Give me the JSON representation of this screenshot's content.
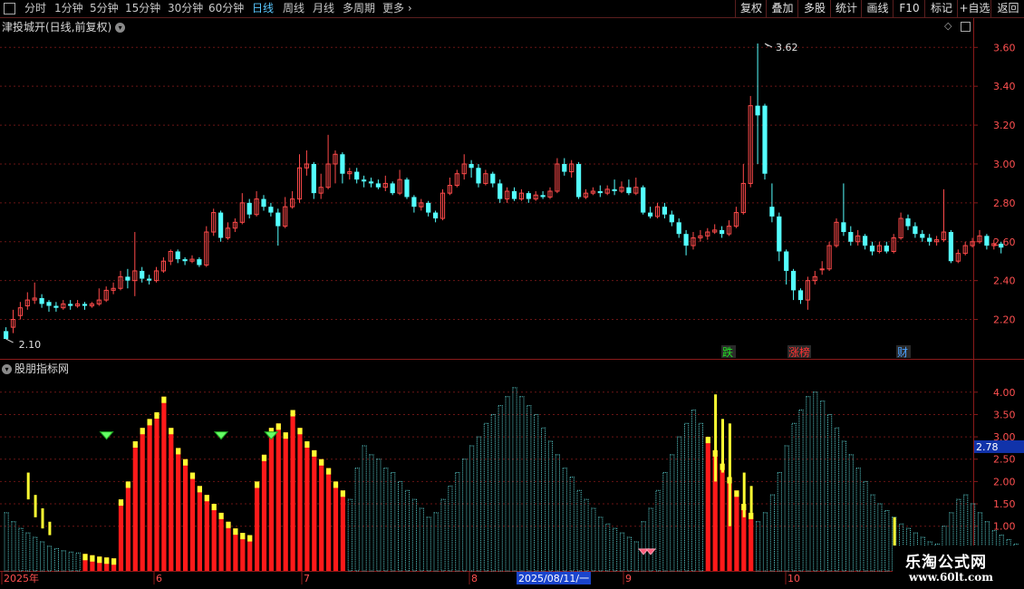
{
  "toolbar": {
    "periods": [
      {
        "label": "分时",
        "active": false
      },
      {
        "label": "1分钟",
        "active": false
      },
      {
        "label": "5分钟",
        "active": false
      },
      {
        "label": "15分钟",
        "active": false
      },
      {
        "label": "30分钟",
        "active": false
      },
      {
        "label": "60分钟",
        "active": false
      },
      {
        "label": "日线",
        "active": true
      },
      {
        "label": "周线",
        "active": false
      },
      {
        "label": "月线",
        "active": false
      },
      {
        "label": "多周期",
        "active": false
      },
      {
        "label": "更多",
        "active": false
      }
    ],
    "more_arrow": "›",
    "right_buttons": [
      "复权",
      "叠加",
      "多股",
      "统计",
      "画线",
      "F10",
      "标记",
      "+自选",
      "返回"
    ]
  },
  "price_panel": {
    "title": "津投城开(日线,前复权)",
    "y_ticks": [
      "3.60",
      "3.40",
      "3.20",
      "3.00",
      "2.80",
      "2.60",
      "2.40",
      "2.20"
    ],
    "high_label": "3.62",
    "low_label": "2.10",
    "markers": [
      {
        "text": "跌",
        "color": "#22dd22"
      },
      {
        "text": "涨榜",
        "color": "#ff3333"
      },
      {
        "text": "财",
        "color": "#4aa0ff"
      }
    ]
  },
  "indicator_panel": {
    "title": "股朋指标网",
    "y_ticks": [
      "4.00",
      "3.50",
      "3.00",
      "2.50",
      "2.00",
      "1.50",
      "1.00"
    ],
    "current_value": "2.78"
  },
  "x_axis": {
    "labels": [
      "2025年",
      "6",
      "7",
      "8",
      "9",
      "10"
    ],
    "cursor_date": "2025/08/11/一"
  },
  "watermark": {
    "line1": "乐淘公式网",
    "line2": "www.60lt.com"
  },
  "colors": {
    "up": "#ff4a4a",
    "down": "#54ffff",
    "grid": "#6a1515",
    "axis_text": "#ff5050",
    "highlight_box": "#1a44cc",
    "bar_red": "#ff1a1a",
    "bar_yellow": "#ffff33",
    "bar_cyan": "#5ad0d0"
  },
  "chart_data": {
    "type": "candlestick",
    "start_index_label": "2025年",
    "candles": [
      [
        2.14,
        2.1,
        2.16,
        2.1
      ],
      [
        2.16,
        2.2,
        2.25,
        2.13
      ],
      [
        2.22,
        2.26,
        2.29,
        2.2
      ],
      [
        2.27,
        2.3,
        2.34,
        2.25
      ],
      [
        2.3,
        2.31,
        2.39,
        2.28
      ],
      [
        2.31,
        2.28,
        2.33,
        2.26
      ],
      [
        2.29,
        2.27,
        2.3,
        2.24
      ],
      [
        2.27,
        2.26,
        2.29,
        2.24
      ],
      [
        2.26,
        2.28,
        2.3,
        2.25
      ],
      [
        2.28,
        2.27,
        2.3,
        2.25
      ],
      [
        2.27,
        2.28,
        2.3,
        2.26
      ],
      [
        2.28,
        2.27,
        2.29,
        2.25
      ],
      [
        2.27,
        2.28,
        2.29,
        2.26
      ],
      [
        2.28,
        2.3,
        2.36,
        2.27
      ],
      [
        2.3,
        2.35,
        2.37,
        2.29
      ],
      [
        2.35,
        2.36,
        2.39,
        2.33
      ],
      [
        2.36,
        2.42,
        2.45,
        2.35
      ],
      [
        2.42,
        2.4,
        2.46,
        2.36
      ],
      [
        2.4,
        2.45,
        2.65,
        2.32
      ],
      [
        2.45,
        2.41,
        2.47,
        2.39
      ],
      [
        2.41,
        2.4,
        2.43,
        2.38
      ],
      [
        2.4,
        2.45,
        2.47,
        2.39
      ],
      [
        2.45,
        2.5,
        2.52,
        2.44
      ],
      [
        2.5,
        2.55,
        2.56,
        2.48
      ],
      [
        2.55,
        2.51,
        2.56,
        2.49
      ],
      [
        2.51,
        2.5,
        2.52,
        2.48
      ],
      [
        2.5,
        2.51,
        2.53,
        2.49
      ],
      [
        2.51,
        2.48,
        2.52,
        2.47
      ],
      [
        2.48,
        2.65,
        2.68,
        2.47
      ],
      [
        2.65,
        2.75,
        2.77,
        2.63
      ],
      [
        2.75,
        2.62,
        2.76,
        2.6
      ],
      [
        2.62,
        2.67,
        2.7,
        2.61
      ],
      [
        2.67,
        2.7,
        2.72,
        2.65
      ],
      [
        2.7,
        2.8,
        2.85,
        2.69
      ],
      [
        2.8,
        2.74,
        2.82,
        2.72
      ],
      [
        2.74,
        2.82,
        2.86,
        2.73
      ],
      [
        2.82,
        2.78,
        2.84,
        2.76
      ],
      [
        2.78,
        2.75,
        2.8,
        2.73
      ],
      [
        2.75,
        2.68,
        2.77,
        2.58
      ],
      [
        2.68,
        2.78,
        2.83,
        2.67
      ],
      [
        2.78,
        2.82,
        2.86,
        2.77
      ],
      [
        2.82,
        2.98,
        3.05,
        2.8
      ],
      [
        2.98,
        3.0,
        3.07,
        2.94
      ],
      [
        3.0,
        2.85,
        3.01,
        2.82
      ],
      [
        2.85,
        2.88,
        2.95,
        2.82
      ],
      [
        2.88,
        3.0,
        3.15,
        2.87
      ],
      [
        3.0,
        3.05,
        3.07,
        2.9
      ],
      [
        3.05,
        2.95,
        3.06,
        2.9
      ],
      [
        2.95,
        2.96,
        2.98,
        2.92
      ],
      [
        2.96,
        2.92,
        2.98,
        2.9
      ],
      [
        2.92,
        2.91,
        2.94,
        2.88
      ],
      [
        2.91,
        2.9,
        2.93,
        2.88
      ],
      [
        2.9,
        2.88,
        2.92,
        2.87
      ],
      [
        2.88,
        2.9,
        2.94,
        2.86
      ],
      [
        2.9,
        2.85,
        2.91,
        2.84
      ],
      [
        2.85,
        2.92,
        2.97,
        2.84
      ],
      [
        2.92,
        2.83,
        2.93,
        2.82
      ],
      [
        2.83,
        2.78,
        2.84,
        2.75
      ],
      [
        2.78,
        2.8,
        2.82,
        2.76
      ],
      [
        2.8,
        2.75,
        2.81,
        2.73
      ],
      [
        2.75,
        2.72,
        2.76,
        2.7
      ],
      [
        2.72,
        2.85,
        2.87,
        2.71
      ],
      [
        2.85,
        2.89,
        2.93,
        2.84
      ],
      [
        2.89,
        2.95,
        2.97,
        2.88
      ],
      [
        2.95,
        3.0,
        3.05,
        2.92
      ],
      [
        3.0,
        2.98,
        3.02,
        2.93
      ],
      [
        2.98,
        2.9,
        3.0,
        2.88
      ],
      [
        2.9,
        2.95,
        2.97,
        2.89
      ],
      [
        2.95,
        2.9,
        2.96,
        2.88
      ],
      [
        2.9,
        2.82,
        2.92,
        2.8
      ],
      [
        2.82,
        2.86,
        2.88,
        2.8
      ],
      [
        2.86,
        2.82,
        2.88,
        2.81
      ],
      [
        2.82,
        2.85,
        2.87,
        2.81
      ],
      [
        2.85,
        2.82,
        2.86,
        2.8
      ],
      [
        2.82,
        2.84,
        2.86,
        2.81
      ],
      [
        2.84,
        2.83,
        2.86,
        2.82
      ],
      [
        2.83,
        2.86,
        2.88,
        2.82
      ],
      [
        2.86,
        3.0,
        3.03,
        2.85
      ],
      [
        3.0,
        2.96,
        3.03,
        2.94
      ],
      [
        2.96,
        3.0,
        3.02,
        2.93
      ],
      [
        3.0,
        2.83,
        3.01,
        2.82
      ],
      [
        2.83,
        2.85,
        2.87,
        2.82
      ],
      [
        2.85,
        2.86,
        2.88,
        2.84
      ],
      [
        2.86,
        2.85,
        2.89,
        2.83
      ],
      [
        2.85,
        2.87,
        2.89,
        2.84
      ],
      [
        2.87,
        2.86,
        2.92,
        2.84
      ],
      [
        2.86,
        2.88,
        2.91,
        2.85
      ],
      [
        2.88,
        2.85,
        2.92,
        2.84
      ],
      [
        2.85,
        2.88,
        2.93,
        2.84
      ],
      [
        2.88,
        2.75,
        2.89,
        2.74
      ],
      [
        2.75,
        2.73,
        2.78,
        2.72
      ],
      [
        2.73,
        2.78,
        2.8,
        2.72
      ],
      [
        2.78,
        2.74,
        2.8,
        2.72
      ],
      [
        2.74,
        2.7,
        2.76,
        2.68
      ],
      [
        2.7,
        2.64,
        2.72,
        2.62
      ],
      [
        2.64,
        2.58,
        2.66,
        2.53
      ],
      [
        2.58,
        2.62,
        2.65,
        2.56
      ],
      [
        2.62,
        2.63,
        2.66,
        2.6
      ],
      [
        2.63,
        2.65,
        2.67,
        2.61
      ],
      [
        2.65,
        2.66,
        2.69,
        2.64
      ],
      [
        2.66,
        2.64,
        2.68,
        2.62
      ],
      [
        2.64,
        2.68,
        2.71,
        2.63
      ],
      [
        2.68,
        2.75,
        2.78,
        2.67
      ],
      [
        2.75,
        2.9,
        3.0,
        2.74
      ],
      [
        2.9,
        3.3,
        3.35,
        2.88
      ],
      [
        3.3,
        3.25,
        3.62,
        3.0
      ],
      [
        3.3,
        2.95,
        3.31,
        2.92
      ],
      [
        2.78,
        2.73,
        2.9,
        2.7
      ],
      [
        2.73,
        2.55,
        2.75,
        2.5
      ],
      [
        2.55,
        2.45,
        2.56,
        2.38
      ],
      [
        2.45,
        2.35,
        2.46,
        2.3
      ],
      [
        2.35,
        2.3,
        2.36,
        2.28
      ],
      [
        2.3,
        2.4,
        2.42,
        2.25
      ],
      [
        2.4,
        2.42,
        2.45,
        2.38
      ],
      [
        2.46,
        2.46,
        2.5,
        2.43
      ],
      [
        2.46,
        2.58,
        2.6,
        2.45
      ],
      [
        2.58,
        2.7,
        2.72,
        2.57
      ],
      [
        2.7,
        2.65,
        2.9,
        2.63
      ],
      [
        2.65,
        2.6,
        2.68,
        2.58
      ],
      [
        2.6,
        2.63,
        2.66,
        2.58
      ],
      [
        2.63,
        2.58,
        2.64,
        2.56
      ],
      [
        2.58,
        2.55,
        2.6,
        2.53
      ],
      [
        2.55,
        2.58,
        2.6,
        2.54
      ],
      [
        2.58,
        2.55,
        2.6,
        2.54
      ],
      [
        2.55,
        2.62,
        2.64,
        2.54
      ],
      [
        2.62,
        2.72,
        2.75,
        2.61
      ],
      [
        2.72,
        2.68,
        2.74,
        2.66
      ],
      [
        2.68,
        2.64,
        2.7,
        2.62
      ],
      [
        2.64,
        2.62,
        2.66,
        2.6
      ],
      [
        2.62,
        2.6,
        2.64,
        2.58
      ],
      [
        2.6,
        2.61,
        2.63,
        2.58
      ],
      [
        2.61,
        2.65,
        2.87,
        2.6
      ],
      [
        2.65,
        2.5,
        2.66,
        2.49
      ],
      [
        2.5,
        2.54,
        2.56,
        2.49
      ],
      [
        2.54,
        2.58,
        2.6,
        2.53
      ],
      [
        2.58,
        2.6,
        2.62,
        2.57
      ],
      [
        2.6,
        2.63,
        2.66,
        2.59
      ],
      [
        2.63,
        2.58,
        2.64,
        2.56
      ],
      [
        2.58,
        2.59,
        2.61,
        2.56
      ],
      [
        2.59,
        2.57,
        2.6,
        2.54
      ]
    ],
    "indicator_values": [
      1.3,
      1.1,
      0.95,
      0.85,
      0.75,
      0.65,
      0.55,
      0.5,
      0.45,
      0.42,
      0.4,
      0.38,
      0.35,
      0.32,
      0.3,
      0.28,
      1.6,
      2.0,
      2.9,
      3.2,
      3.4,
      3.55,
      3.9,
      3.2,
      2.75,
      2.5,
      2.2,
      1.9,
      1.7,
      1.5,
      1.3,
      1.1,
      0.95,
      0.85,
      0.8,
      2.0,
      2.6,
      3.2,
      3.3,
      3.1,
      3.6,
      3.2,
      2.9,
      2.7,
      2.5,
      2.3,
      2.0,
      1.8,
      1.6,
      2.3,
      2.8,
      2.6,
      2.5,
      2.3,
      2.2,
      2.0,
      1.8,
      1.6,
      1.4,
      1.2,
      1.3,
      1.6,
      1.9,
      2.2,
      2.5,
      2.8,
      3.0,
      3.3,
      3.5,
      3.7,
      3.9,
      4.1,
      3.9,
      3.7,
      3.5,
      3.2,
      2.9,
      2.6,
      2.3,
      2.1,
      1.8,
      1.6,
      1.4,
      1.2,
      1.05,
      0.95,
      0.85,
      0.75,
      0.65,
      1.1,
      1.4,
      1.8,
      2.2,
      2.6,
      3.0,
      3.3,
      3.6,
      3.3,
      3.0,
      2.7,
      2.4,
      2.1,
      1.8,
      1.5,
      1.3,
      1.1,
      1.3,
      1.7,
      2.2,
      2.8,
      3.3,
      3.6,
      3.9,
      4.0,
      3.8,
      3.5,
      3.2,
      2.9,
      2.6,
      2.3,
      2.0,
      1.7,
      1.5,
      1.35,
      1.2,
      1.05,
      0.95,
      0.85,
      0.75,
      0.65,
      0.6,
      1.0,
      1.3,
      1.6,
      1.7,
      1.5,
      1.3,
      1.1,
      0.9,
      0.8,
      0.7,
      0.6,
      0.5,
      0.45,
      0.4
    ]
  }
}
